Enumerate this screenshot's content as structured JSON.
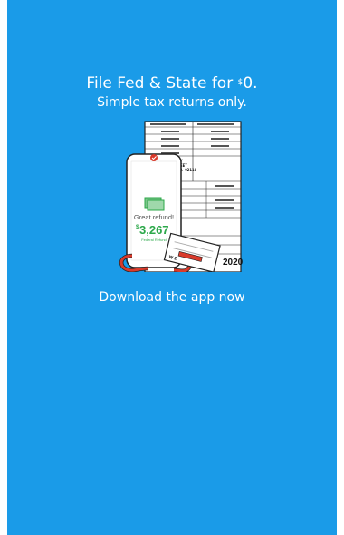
{
  "promo": {
    "headline_prefix": "File Fed & State for ",
    "headline_currency": "$",
    "headline_amount": "0.",
    "subline": "Simple tax returns only.",
    "cta": "Download the app now"
  },
  "illustration": {
    "phone_label": "Great refund!",
    "refund_currency": "$",
    "refund_amount": "3,267",
    "refund_caption": "Federal Refund",
    "form_year": "2020",
    "form_company_line1": "BALOR COMPANY",
    "form_company_line2": "123 MAIN STREET",
    "form_company_line3": "SAN DIEGO, CA 92110",
    "w2_label": "W-2"
  },
  "colors": {
    "background": "#1a9be8",
    "refund_green": "#2ca84a",
    "character_red": "#d93a2b"
  }
}
